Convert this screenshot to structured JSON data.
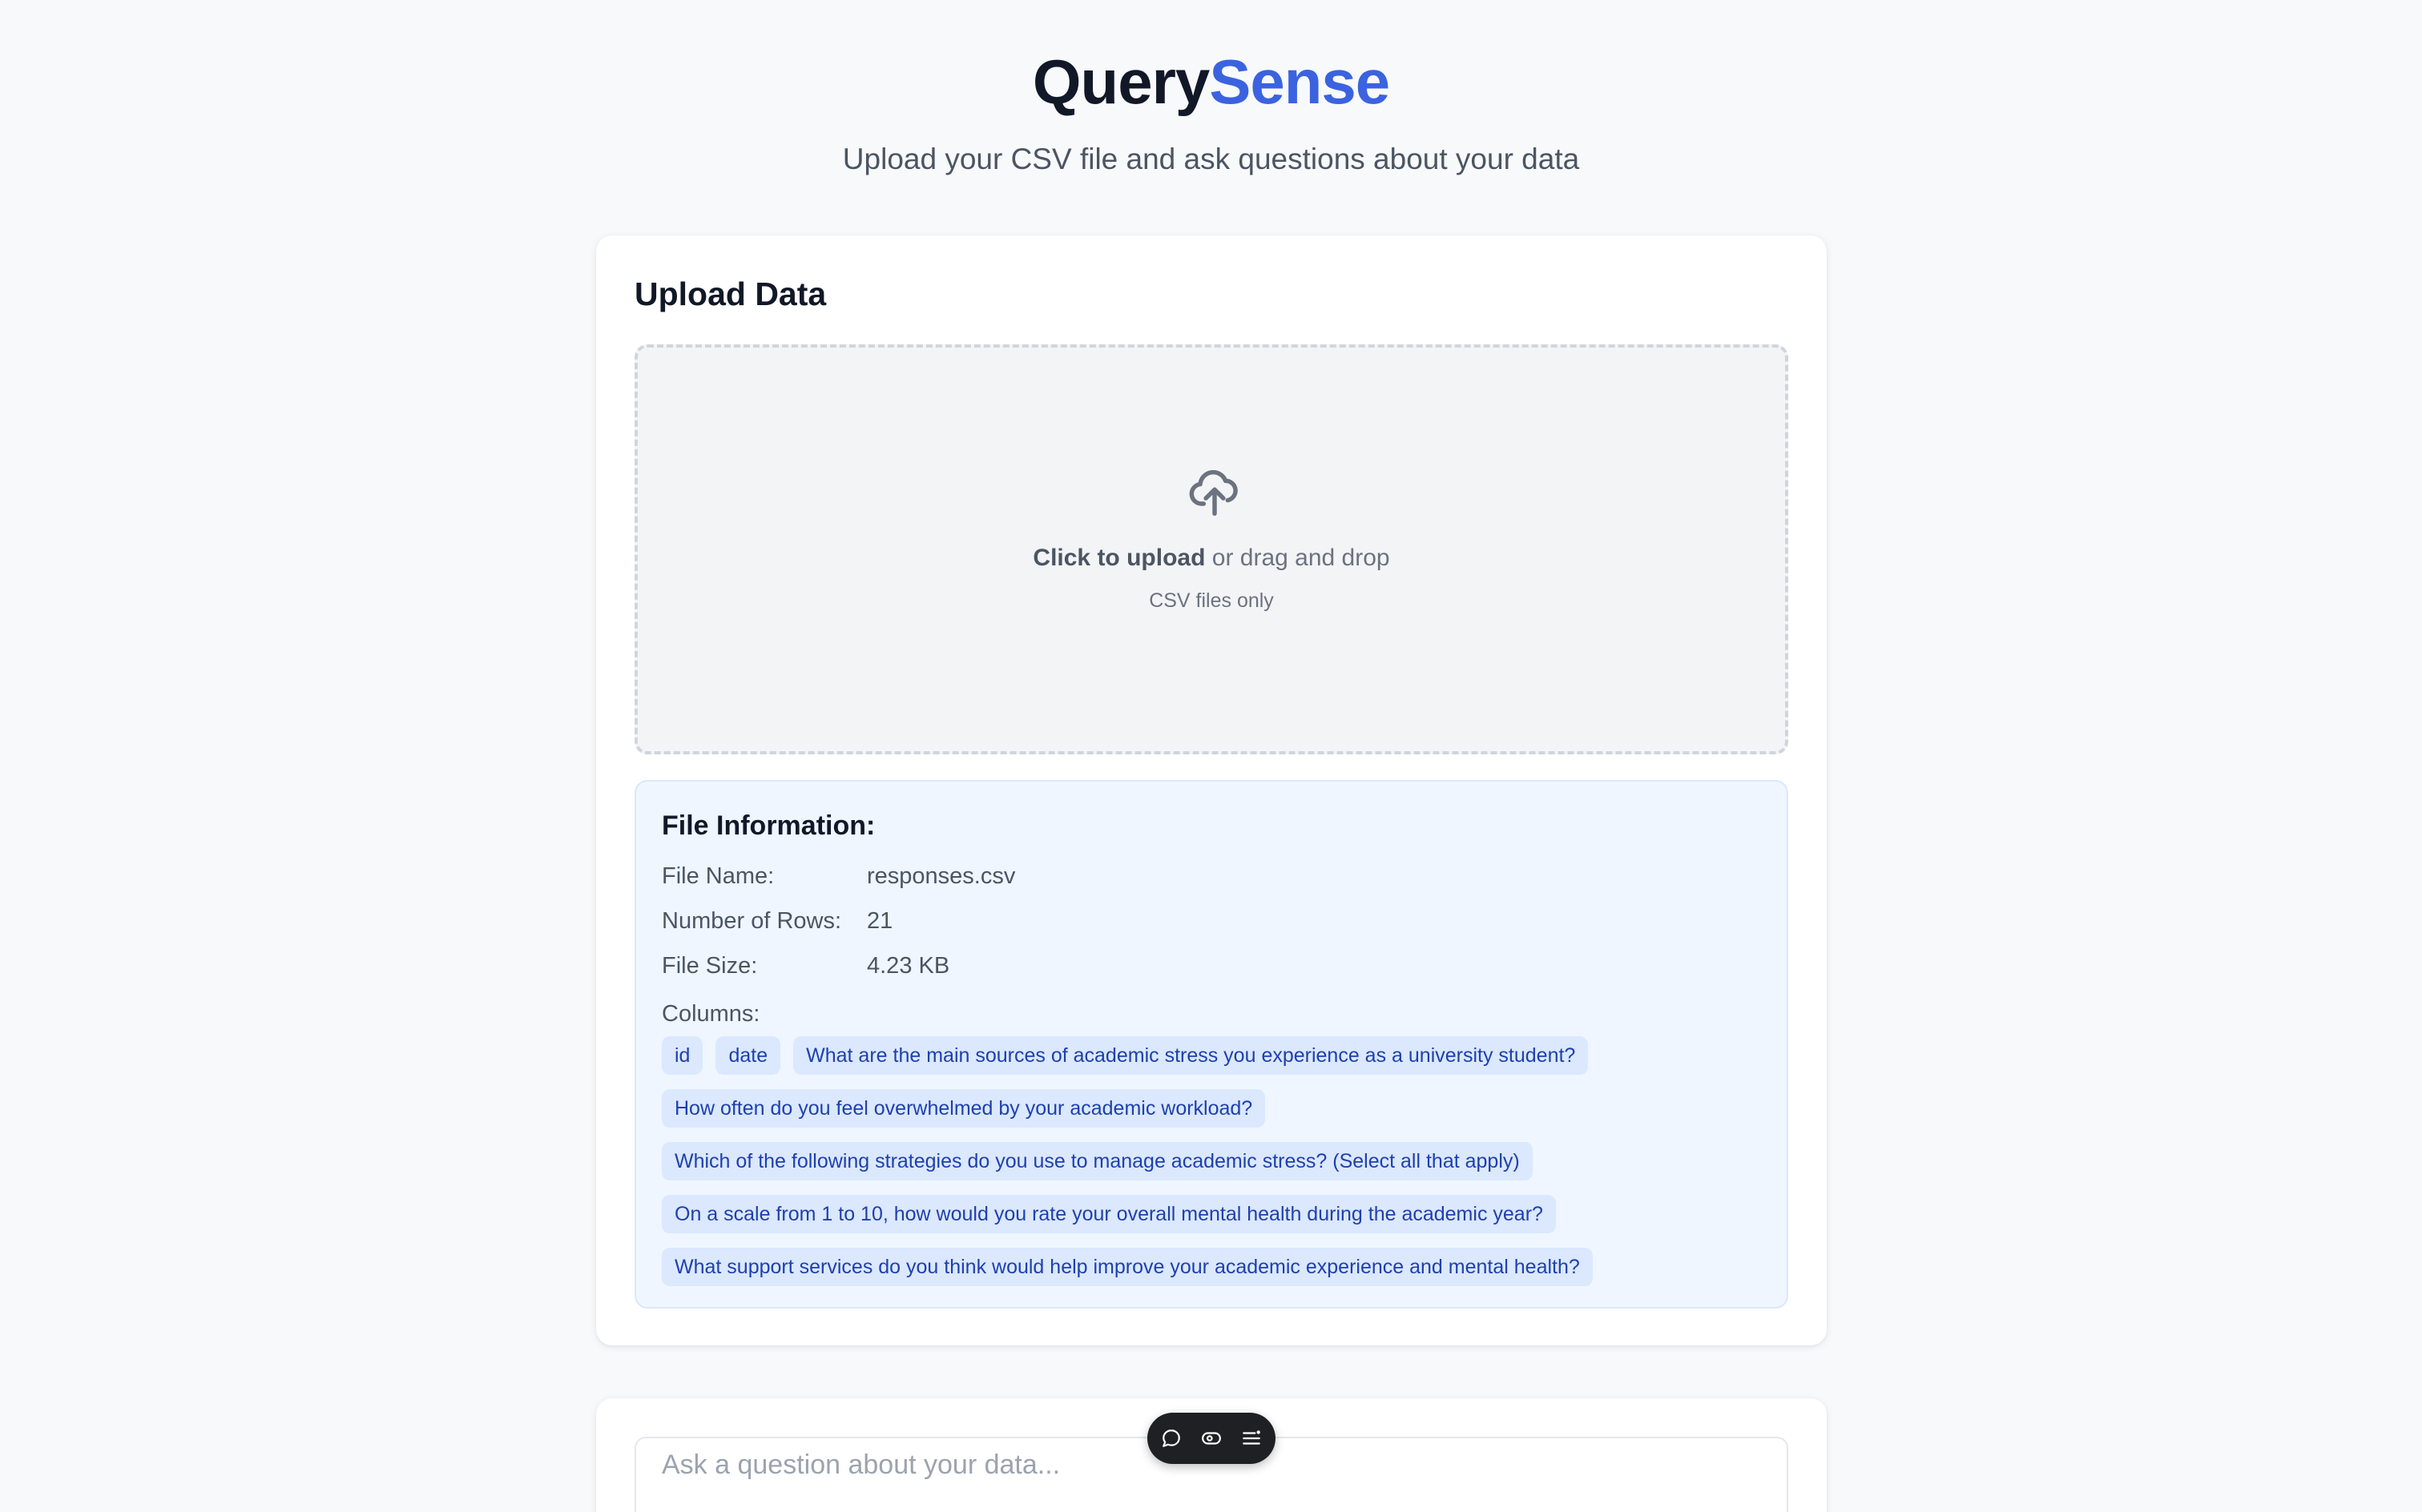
{
  "header": {
    "brand_part1": "Query",
    "brand_part2": "Sense",
    "subtitle": "Upload your CSV file and ask questions about your data",
    "brand_color": "#3b63e0"
  },
  "upload": {
    "title": "Upload Data",
    "click_text": "Click to upload",
    "drag_text": " or drag and drop",
    "hint": "CSV files only",
    "icon": "cloud-upload-icon"
  },
  "file_info": {
    "title": "File Information:",
    "name_label": "File Name:",
    "name_value": "responses.csv",
    "rows_label": "Number of Rows:",
    "rows_value": "21",
    "size_label": "File Size:",
    "size_value": "4.23 KB",
    "columns_label": "Columns:",
    "columns": [
      "id",
      "date",
      "What are the main sources of academic stress you experience as a university student?",
      "How often do you feel overwhelmed by your academic workload?",
      "Which of the following strategies do you use to manage academic stress? (Select all that apply)",
      "On a scale from 1 to 10, how would you rate your overall mental health during the academic year?",
      "What support services do you think would help improve your academic experience and mental health?"
    ]
  },
  "query": {
    "placeholder": "Ask a question about your data..."
  },
  "toolbar": {
    "icons": [
      "comment-icon",
      "eye-toggle-icon",
      "list-icon"
    ]
  }
}
